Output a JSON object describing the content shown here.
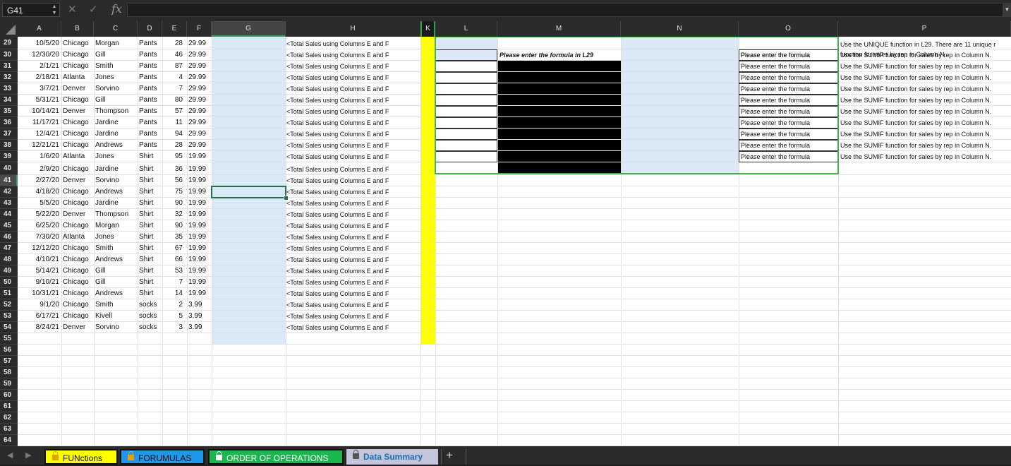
{
  "formula_bar": {
    "name_box": "G41",
    "cancel_glyph": "✕",
    "enter_glyph": "✓",
    "fx_label": "fx",
    "formula": ""
  },
  "columns": [
    "A",
    "B",
    "C",
    "D",
    "E",
    "F",
    "G",
    "H",
    "K",
    "L",
    "M",
    "N",
    "O",
    "P"
  ],
  "rows": [
    "29",
    "30",
    "31",
    "32",
    "33",
    "34",
    "35",
    "36",
    "37",
    "38",
    "39",
    "40",
    "41",
    "42",
    "43",
    "44",
    "45",
    "46",
    "47",
    "48",
    "49",
    "50",
    "51",
    "52",
    "53",
    "54",
    "55",
    "56",
    "57",
    "58",
    "59",
    "60",
    "61",
    "62",
    "63",
    "64"
  ],
  "data_rows": [
    {
      "date": "10/5/20",
      "city": "Chicago",
      "rep": "Morgan",
      "item": "Pants",
      "qty": "28",
      "price": "29.99"
    },
    {
      "date": "12/30/20",
      "city": "Chicago",
      "rep": "Gill",
      "item": "Pants",
      "qty": "46",
      "price": "29.99"
    },
    {
      "date": "2/1/21",
      "city": "Chicago",
      "rep": "Smith",
      "item": "Pants",
      "qty": "87",
      "price": "29.99"
    },
    {
      "date": "2/18/21",
      "city": "Atlanta",
      "rep": "Jones",
      "item": "Pants",
      "qty": "4",
      "price": "29.99"
    },
    {
      "date": "3/7/21",
      "city": "Denver",
      "rep": "Sorvino",
      "item": "Pants",
      "qty": "7",
      "price": "29.99"
    },
    {
      "date": "5/31/21",
      "city": "Chicago",
      "rep": "Gill",
      "item": "Pants",
      "qty": "80",
      "price": "29.99"
    },
    {
      "date": "10/14/21",
      "city": "Denver",
      "rep": "Thompson",
      "item": "Pants",
      "qty": "57",
      "price": "29.99"
    },
    {
      "date": "11/17/21",
      "city": "Chicago",
      "rep": "Jardine",
      "item": "Pants",
      "qty": "11",
      "price": "29.99"
    },
    {
      "date": "12/4/21",
      "city": "Chicago",
      "rep": "Jardine",
      "item": "Pants",
      "qty": "94",
      "price": "29.99"
    },
    {
      "date": "12/21/21",
      "city": "Chicago",
      "rep": "Andrews",
      "item": "Pants",
      "qty": "28",
      "price": "29.99"
    },
    {
      "date": "1/6/20",
      "city": "Atlanta",
      "rep": "Jones",
      "item": "Shirt",
      "qty": "95",
      "price": "19.99"
    },
    {
      "date": "2/9/20",
      "city": "Chicago",
      "rep": "Jardine",
      "item": "Shirt",
      "qty": "36",
      "price": "19.99"
    },
    {
      "date": "2/27/20",
      "city": "Denver",
      "rep": "Sorvino",
      "item": "Shirt",
      "qty": "56",
      "price": "19.99"
    },
    {
      "date": "4/18/20",
      "city": "Chicago",
      "rep": "Andrews",
      "item": "Shirt",
      "qty": "75",
      "price": "19.99"
    },
    {
      "date": "5/5/20",
      "city": "Chicago",
      "rep": "Jardine",
      "item": "Shirt",
      "qty": "90",
      "price": "19.99"
    },
    {
      "date": "5/22/20",
      "city": "Denver",
      "rep": "Thompson",
      "item": "Shirt",
      "qty": "32",
      "price": "19.99"
    },
    {
      "date": "6/25/20",
      "city": "Chicago",
      "rep": "Morgan",
      "item": "Shirt",
      "qty": "90",
      "price": "19.99"
    },
    {
      "date": "7/30/20",
      "city": "Atlanta",
      "rep": "Jones",
      "item": "Shirt",
      "qty": "35",
      "price": "19.99"
    },
    {
      "date": "12/12/20",
      "city": "Chicago",
      "rep": "Smith",
      "item": "Shirt",
      "qty": "67",
      "price": "19.99"
    },
    {
      "date": "4/10/21",
      "city": "Chicago",
      "rep": "Andrews",
      "item": "Shirt",
      "qty": "66",
      "price": "19.99"
    },
    {
      "date": "5/14/21",
      "city": "Chicago",
      "rep": "Gill",
      "item": "Shirt",
      "qty": "53",
      "price": "19.99"
    },
    {
      "date": "9/10/21",
      "city": "Chicago",
      "rep": "Gill",
      "item": "Shirt",
      "qty": "7",
      "price": "19.99"
    },
    {
      "date": "10/31/21",
      "city": "Chicago",
      "rep": "Andrews",
      "item": "Shirt",
      "qty": "14",
      "price": "19.99"
    },
    {
      "date": "9/1/20",
      "city": "Chicago",
      "rep": "Smith",
      "item": "socks",
      "qty": "2",
      "price": "3.99"
    },
    {
      "date": "6/17/21",
      "city": "Chicago",
      "rep": "Kivell",
      "item": "socks",
      "qty": "5",
      "price": "3.99"
    },
    {
      "date": "8/24/21",
      "city": "Denver",
      "rep": "Sorvino",
      "item": "socks",
      "qty": "3",
      "price": "3.99"
    }
  ],
  "h_note": "<Total Sales using Columns E and F",
  "summary": {
    "m_note": "Please enter the formula in L29",
    "o_note": "Please enter the formula",
    "p_first_line1": "Use the UNIQUE function in L29. There are 11 unique r",
    "p_first_line2": "function for sales by rep in Column N.",
    "p_note": "Use the SUMIF function for sales by rep in Column N."
  },
  "sheet_tabs": [
    {
      "label": "FUNctions"
    },
    {
      "label": "FORUMULAS"
    },
    {
      "label": "ORDER OF OPERATIONS"
    },
    {
      "label": "Data Summary"
    }
  ],
  "add_sheet": "+",
  "colors": {
    "yellow": "#ffff00",
    "light_blue": "#dbe9f6",
    "selection_green": "#217346",
    "summary_border_green": "#4caf50"
  }
}
